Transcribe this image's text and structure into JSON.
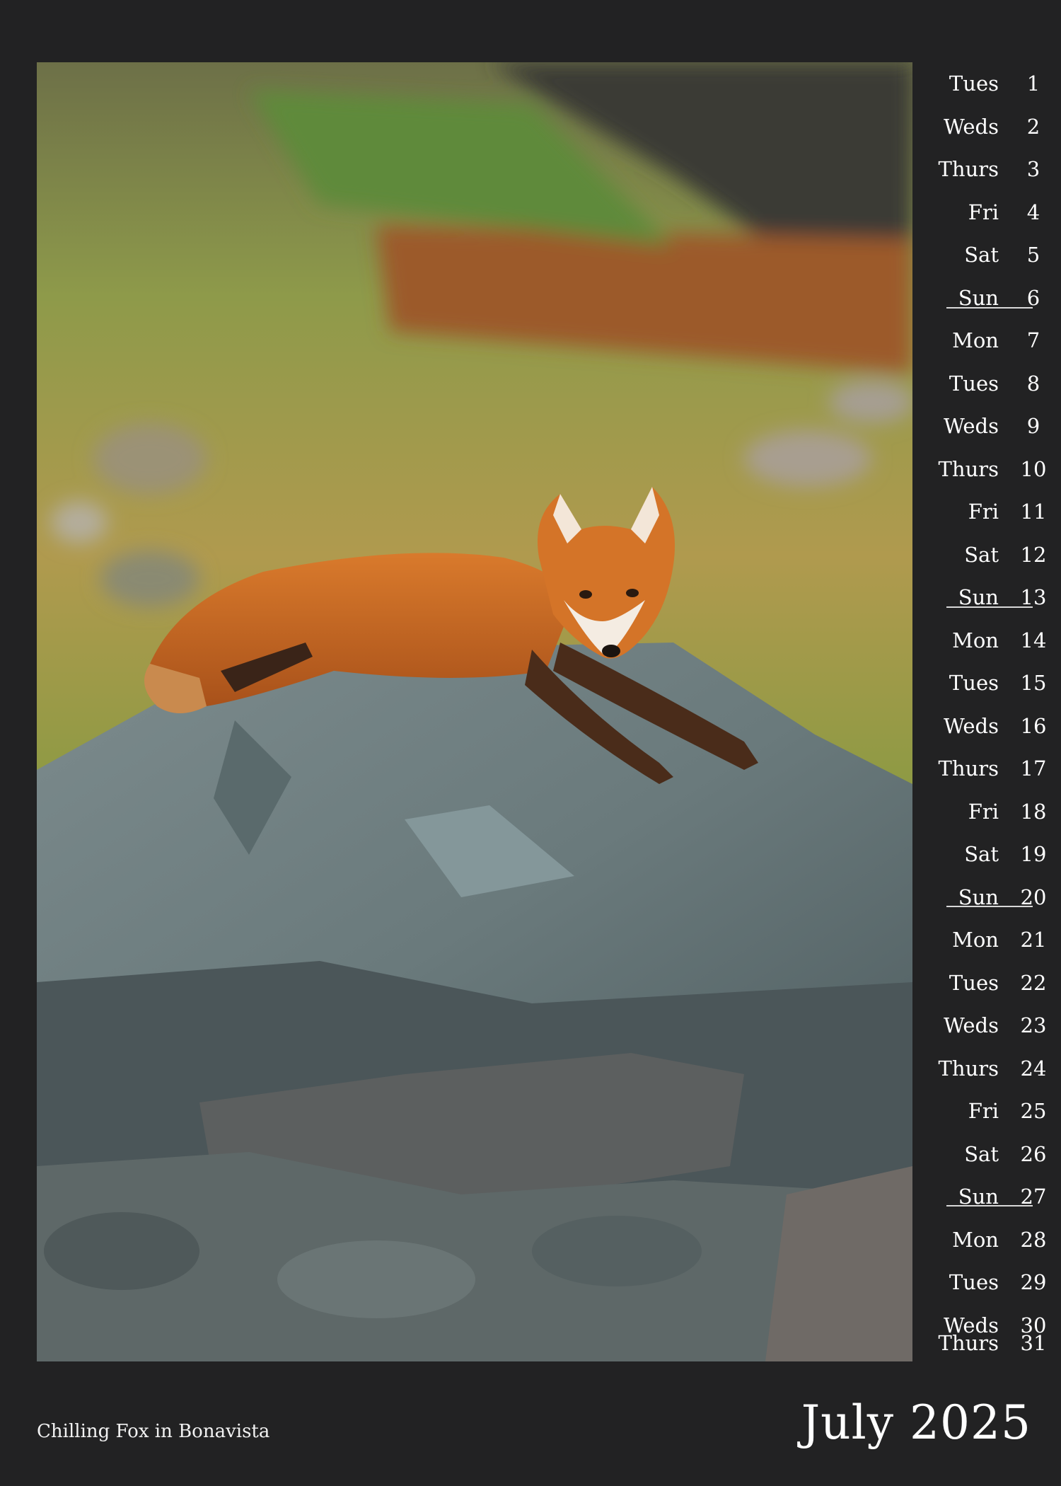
{
  "days": [
    {
      "name": "Tues",
      "date": "1"
    },
    {
      "name": "Weds",
      "date": "2"
    },
    {
      "name": "Thurs",
      "date": "3"
    },
    {
      "name": "Fri",
      "date": "4"
    },
    {
      "name": "Sat",
      "date": "5"
    },
    {
      "name": "Sun",
      "date": "6"
    },
    {
      "name": "Mon",
      "date": "7"
    },
    {
      "name": "Tues",
      "date": "8"
    },
    {
      "name": "Weds",
      "date": "9"
    },
    {
      "name": "Thurs",
      "date": "10"
    },
    {
      "name": "Fri",
      "date": "11"
    },
    {
      "name": "Sat",
      "date": "12"
    },
    {
      "name": "Sun",
      "date": "13"
    },
    {
      "name": "Mon",
      "date": "14"
    },
    {
      "name": "Tues",
      "date": "15"
    },
    {
      "name": "Weds",
      "date": "16"
    },
    {
      "name": "Thurs",
      "date": "17"
    },
    {
      "name": "Fri",
      "date": "18"
    },
    {
      "name": "Sat",
      "date": "19"
    },
    {
      "name": "Sun",
      "date": "20"
    },
    {
      "name": "Mon",
      "date": "21"
    },
    {
      "name": "Tues",
      "date": "22"
    },
    {
      "name": "Weds",
      "date": "23"
    },
    {
      "name": "Thurs",
      "date": "24"
    },
    {
      "name": "Fri",
      "date": "25"
    },
    {
      "name": "Sat",
      "date": "26"
    },
    {
      "name": "Sun",
      "date": "27"
    },
    {
      "name": "Mon",
      "date": "28"
    },
    {
      "name": "Tues",
      "date": "29"
    },
    {
      "name": "Weds",
      "date": "30"
    },
    {
      "name": "Thurs",
      "date": "31"
    }
  ],
  "caption": "Chilling Fox in Bonavista",
  "month_title": "July 2025",
  "colors": {
    "background": "#222223",
    "text": "#ffffff",
    "fox": "#c9661f",
    "rock": "#6b7b7d",
    "grass": "#8a9a3c"
  }
}
